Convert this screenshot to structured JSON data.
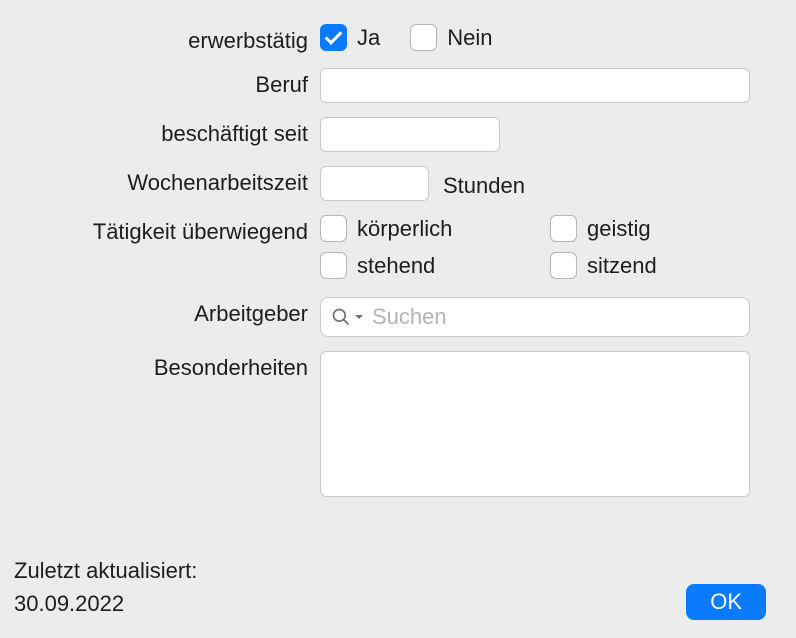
{
  "labels": {
    "employed": "erwerbstätig",
    "yes": "Ja",
    "no": "Nein",
    "occupation": "Beruf",
    "employed_since": "beschäftigt seit",
    "weekly_hours": "Wochenarbeitszeit",
    "hours_unit": "Stunden",
    "activity_mainly": "Tätigkeit überwiegend",
    "physical": "körperlich",
    "mental": "geistig",
    "standing": "stehend",
    "sitting": "sitzend",
    "employer": "Arbeitgeber",
    "search_placeholder": "Suchen",
    "notes": "Besonderheiten",
    "last_updated_label": "Zuletzt aktualisiert:",
    "ok": "OK"
  },
  "values": {
    "employed_yes": true,
    "employed_no": false,
    "occupation": "",
    "employed_since": "",
    "weekly_hours": "",
    "physical": false,
    "mental": false,
    "standing": false,
    "sitting": false,
    "employer_search": "",
    "notes": "",
    "last_updated_date": "30.09.2022"
  }
}
